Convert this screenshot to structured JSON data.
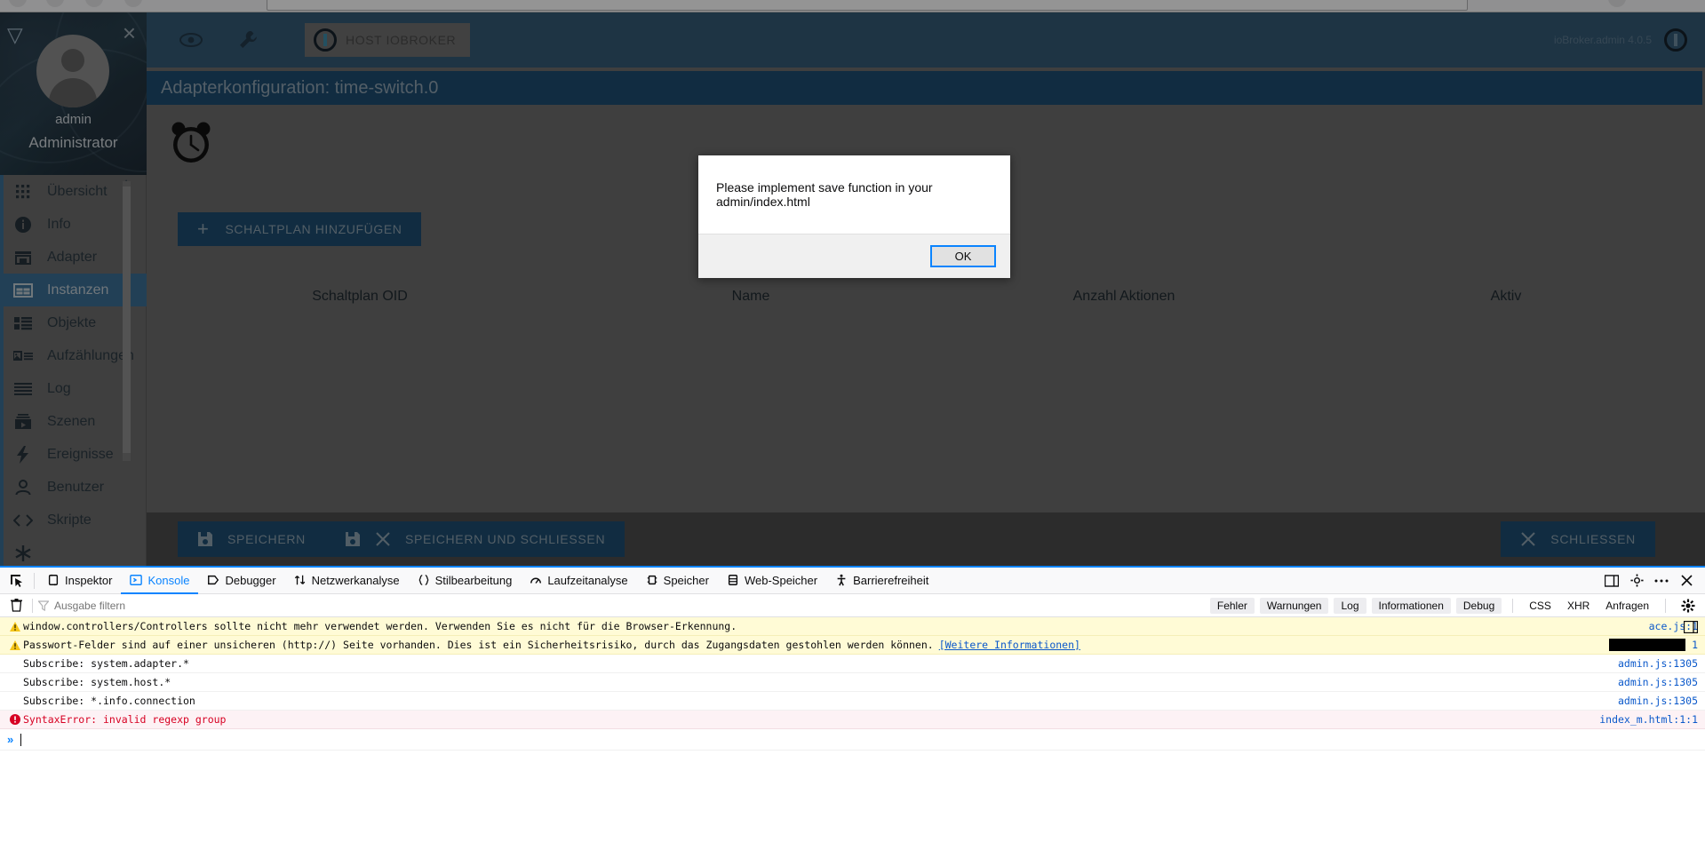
{
  "browser": {
    "chrome_strip": "visible"
  },
  "app": {
    "topbar": {
      "eye_icon": "eye-icon",
      "wrench_icon": "wrench-icon",
      "host_chip_label": "HOST IOBROKER",
      "version": "ioBroker.admin 4.0.5"
    },
    "sidebar": {
      "collapse_icon": "triangle-collapse-icon",
      "close_icon": "close-icon",
      "user_name": "admin",
      "user_role": "Administrator",
      "items": [
        {
          "label": "Übersicht",
          "icon": "grid-icon",
          "active": false
        },
        {
          "label": "Info",
          "icon": "info-icon",
          "active": false
        },
        {
          "label": "Adapter",
          "icon": "store-icon",
          "active": false
        },
        {
          "label": "Instanzen",
          "icon": "instances-icon",
          "active": true
        },
        {
          "label": "Objekte",
          "icon": "list-icon",
          "active": false
        },
        {
          "label": "Aufzählungen",
          "icon": "enum-icon",
          "active": false
        },
        {
          "label": "Log",
          "icon": "lines-icon",
          "active": false
        },
        {
          "label": "Szenen",
          "icon": "scenes-icon",
          "active": false
        },
        {
          "label": "Ereignisse",
          "icon": "bolt-icon",
          "active": false
        },
        {
          "label": "Benutzer",
          "icon": "person-icon",
          "active": false
        },
        {
          "label": "Skripte",
          "icon": "code-icon",
          "active": false
        },
        {
          "label": "",
          "icon": "asterisk-icon",
          "active": false
        }
      ]
    },
    "content": {
      "adapter_title": "Adapterkonfiguration: time-switch.0",
      "adapter_logo": "alarm-clock-icon",
      "add_button": {
        "label": "SCHALTPLAN HINZUFÜGEN",
        "icon": "plus-icon"
      },
      "table_headers": [
        "Schaltplan OID",
        "Name",
        "Anzahl Aktionen",
        "Aktiv"
      ]
    },
    "bottom_bar": {
      "save": {
        "label": "SPEICHERN",
        "icon": "save-icon"
      },
      "save_close": {
        "label": "SPEICHERN UND SCHLIESSEN",
        "icons": [
          "save-icon",
          "close-icon"
        ]
      },
      "close": {
        "label": "SCHLIESSEN",
        "icon": "close-icon"
      }
    }
  },
  "dialog": {
    "message": "Please implement save function in your admin/index.html",
    "ok_label": "OK"
  },
  "devtools": {
    "picker_icon": "element-picker-icon",
    "tabs": [
      {
        "label": "Inspektor",
        "icon": "inspector-icon",
        "active": false
      },
      {
        "label": "Konsole",
        "icon": "console-icon",
        "active": true
      },
      {
        "label": "Debugger",
        "icon": "debugger-icon",
        "active": false
      },
      {
        "label": "Netzwerkanalyse",
        "icon": "network-icon",
        "active": false
      },
      {
        "label": "Stilbearbeitung",
        "icon": "style-editor-icon",
        "active": false
      },
      {
        "label": "Laufzeitanalyse",
        "icon": "performance-icon",
        "active": false
      },
      {
        "label": "Speicher",
        "icon": "memory-icon",
        "active": false
      },
      {
        "label": "Web-Speicher",
        "icon": "storage-icon",
        "active": false
      },
      {
        "label": "Barrierefreiheit",
        "icon": "accessibility-icon",
        "active": false
      }
    ],
    "tab_actions": [
      {
        "icon": "responsive-design-icon"
      },
      {
        "icon": "settings-gear-icon"
      },
      {
        "icon": "more-options-icon"
      },
      {
        "icon": "close-devtools-icon"
      }
    ],
    "toolbar": {
      "clear_icon": "trash-icon",
      "filter_icon": "filter-icon",
      "filter_placeholder": "Ausgabe filtern",
      "filter_value": "",
      "filters": [
        "Fehler",
        "Warnungen",
        "Log",
        "Informationen",
        "Debug"
      ],
      "plain_filters": [
        "CSS",
        "XHR",
        "Anfragen"
      ],
      "settings_icon": "console-settings-icon"
    },
    "messages": [
      {
        "level": "warn",
        "text": "window.controllers/Controllers sollte nicht mehr verwendet werden. Verwenden Sie es nicht für die Browser-Erkennung.",
        "source": "ace.js:1",
        "link_text": ""
      },
      {
        "level": "warn",
        "text": "Passwort-Felder sind auf einer unsicheren (http://) Seite vorhanden. Dies ist ein Sicherheitsrisiko, durch das Zugangsdaten gestohlen werden können.",
        "link_text": "[Weitere Informationen]",
        "source": "1",
        "redacted": true
      },
      {
        "level": "log",
        "text": "Subscribe: system.adapter.*",
        "source": "admin.js:1305",
        "link_text": ""
      },
      {
        "level": "log",
        "text": "Subscribe: system.host.*",
        "source": "admin.js:1305",
        "link_text": ""
      },
      {
        "level": "log",
        "text": "Subscribe: *.info.connection",
        "source": "admin.js:1305",
        "link_text": ""
      },
      {
        "level": "error",
        "text": "SyntaxError: invalid regexp group",
        "source": "index_m.html:1:1",
        "link_text": ""
      }
    ],
    "prompt": {
      "chevron": "»",
      "value": "",
      "split_icon": "split-console-icon"
    }
  },
  "colors": {
    "accent_blue": "#0a84ff",
    "app_blue": "#1e4d70",
    "topbar_blue": "#355a75",
    "dim_gray": "#6d6d6d",
    "warn_bg": "#fffbd6",
    "error_bg": "#fdf2f5"
  }
}
